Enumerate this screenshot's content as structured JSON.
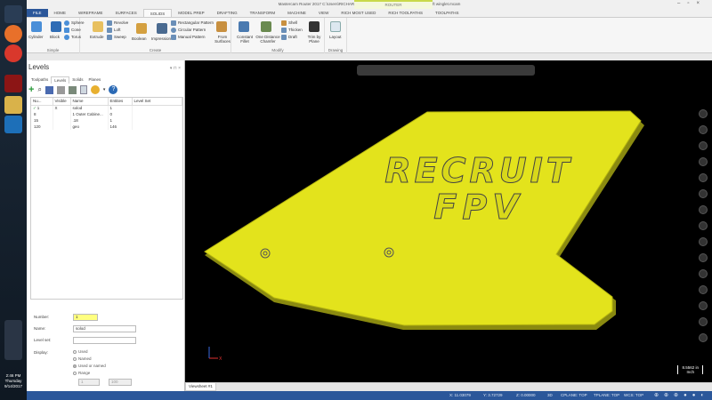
{
  "window_title": "Mastercam Router 2017  C:\\Users\\RICHARD\\Dropbox\\3D PRINTER\\recruit mini wing\\left winglet.mcam",
  "context_tab_header": "ROUTER",
  "tabs": [
    "FILE",
    "HOME",
    "WIREFRAME",
    "SURFACES",
    "SOLIDS",
    "MODEL PREP",
    "DRAFTING",
    "TRANSFORM",
    "MACHINE",
    "VIEW",
    "RICH MOST USED",
    "RICH TOOLPATHS",
    "TOOLPATHS"
  ],
  "ribbon": {
    "simple": {
      "label": "Simple",
      "items": [
        "Cylinder",
        "Block",
        "Sphere",
        "Cone",
        "Torus"
      ]
    },
    "create": {
      "label": "Create",
      "items": [
        "Extrude",
        "Revolve",
        "Loft",
        "Sweep",
        "Boolean",
        "Impression",
        "Rectangular Pattern",
        "Circular Pattern",
        "Manual Pattern",
        "From Surfaces"
      ]
    },
    "modify": {
      "label": "Modify",
      "items": [
        "Constant Fillet",
        "One Distance Chamfer",
        "Shell",
        "Thicken",
        "Draft",
        "Trim by Plane"
      ]
    },
    "drawing": {
      "label": "Drawing",
      "items": [
        "Layout"
      ]
    }
  },
  "panel": {
    "title": "Levels",
    "tabs": [
      "Toolpaths",
      "Levels",
      "Solids",
      "Planes"
    ],
    "columns": [
      "Nu...",
      "Visible",
      "Name",
      "Entities",
      "Level Set"
    ],
    "rows": [
      {
        "num": "1",
        "visible": "X",
        "name": "solod",
        "entities": "1",
        "active": "✓"
      },
      {
        "num": "8",
        "visible": "",
        "name": "1 Outer Cabine...",
        "entities": "0",
        "active": ""
      },
      {
        "num": "15",
        "visible": "",
        "name": ".18",
        "entities": "1",
        "active": ""
      },
      {
        "num": "120",
        "visible": "",
        "name": "geo",
        "entities": "146",
        "active": ""
      }
    ],
    "form": {
      "number_label": "Number:",
      "number_value": "1",
      "name_label": "Name:",
      "name_value": "solod",
      "levelset_label": "Level set:",
      "levelset_value": "",
      "display_label": "Display:",
      "display_options": [
        "Used",
        "Named",
        "Used or named",
        "Range"
      ],
      "range_from": "1",
      "range_to": "100"
    }
  },
  "viewport": {
    "model_text_1": "RECRUIT",
    "model_text_2": "FPV",
    "scale_value": "8.5562 in",
    "scale_unit": "Inch",
    "model_color": "#e3e31c"
  },
  "viewsheet_tab": "Viewsheet #1",
  "status": {
    "x": "X:  11.03079",
    "y": "Y:  3.72729",
    "z": "Z:  0.00000",
    "mode": "3D",
    "cplane": "CPLANE: TOP",
    "tplane": "TPLANE: TOP",
    "wcs": "WCS: TOP"
  },
  "clock": {
    "time": "2:46 PM",
    "day": "Thursday",
    "date": "9/14/2017"
  }
}
